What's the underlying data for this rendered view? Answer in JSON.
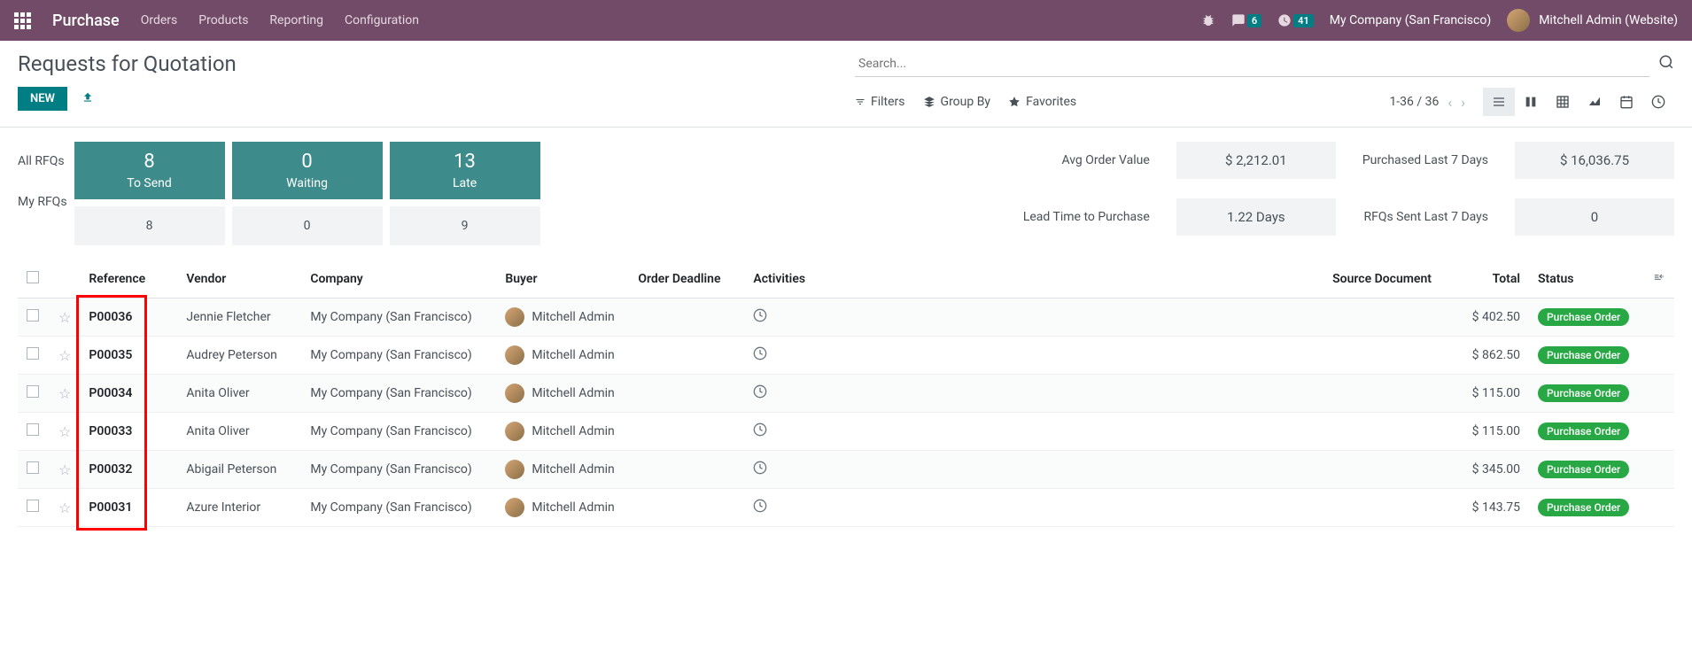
{
  "navbar": {
    "brand": "Purchase",
    "menu": [
      "Orders",
      "Products",
      "Reporting",
      "Configuration"
    ],
    "discuss_badge": "6",
    "activity_badge": "41",
    "company": "My Company (San Francisco)",
    "user": "Mitchell Admin (Website)"
  },
  "page": {
    "title": "Requests for Quotation",
    "new_btn": "NEW",
    "search_placeholder": "Search..."
  },
  "filters": {
    "filters": "Filters",
    "groupby": "Group By",
    "favorites": "Favorites",
    "pager": "1-36 / 36"
  },
  "dashboard": {
    "all_label": "All RFQs",
    "my_label": "My RFQs",
    "cards": [
      {
        "num": "8",
        "txt": "To Send"
      },
      {
        "num": "0",
        "txt": "Waiting"
      },
      {
        "num": "13",
        "txt": "Late"
      }
    ],
    "my_row": [
      "8",
      "0",
      "9"
    ],
    "stats": [
      {
        "label": "Avg Order Value",
        "value": "$ 2,212.01"
      },
      {
        "label": "Purchased Last 7 Days",
        "value": "$ 16,036.75"
      },
      {
        "label": "Lead Time to Purchase",
        "value": "1.22 Days"
      },
      {
        "label": "RFQs Sent Last 7 Days",
        "value": "0"
      }
    ]
  },
  "table": {
    "headers": {
      "reference": "Reference",
      "vendor": "Vendor",
      "company": "Company",
      "buyer": "Buyer",
      "deadline": "Order Deadline",
      "activities": "Activities",
      "source": "Source Document",
      "total": "Total",
      "status": "Status"
    },
    "rows": [
      {
        "ref": "P00036",
        "vendor": "Jennie Fletcher",
        "company": "My Company (San Francisco)",
        "buyer": "Mitchell Admin",
        "total": "$ 402.50",
        "status": "Purchase Order"
      },
      {
        "ref": "P00035",
        "vendor": "Audrey Peterson",
        "company": "My Company (San Francisco)",
        "buyer": "Mitchell Admin",
        "total": "$ 862.50",
        "status": "Purchase Order"
      },
      {
        "ref": "P00034",
        "vendor": "Anita Oliver",
        "company": "My Company (San Francisco)",
        "buyer": "Mitchell Admin",
        "total": "$ 115.00",
        "status": "Purchase Order"
      },
      {
        "ref": "P00033",
        "vendor": "Anita Oliver",
        "company": "My Company (San Francisco)",
        "buyer": "Mitchell Admin",
        "total": "$ 115.00",
        "status": "Purchase Order"
      },
      {
        "ref": "P00032",
        "vendor": "Abigail Peterson",
        "company": "My Company (San Francisco)",
        "buyer": "Mitchell Admin",
        "total": "$ 345.00",
        "status": "Purchase Order"
      },
      {
        "ref": "P00031",
        "vendor": "Azure Interior",
        "company": "My Company (San Francisco)",
        "buyer": "Mitchell Admin",
        "total": "$ 143.75",
        "status": "Purchase Order"
      }
    ]
  }
}
